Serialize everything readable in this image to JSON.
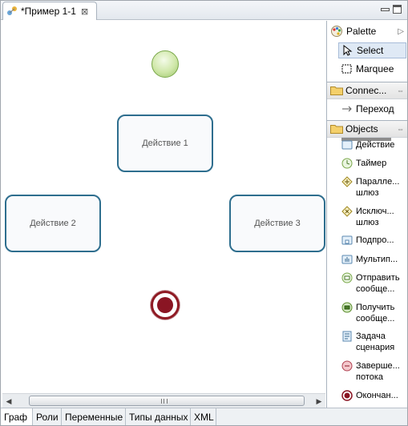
{
  "editor_tab": {
    "title": "*Пример 1-1",
    "close": "⊠"
  },
  "canvas": {
    "nodes": [
      "Действие 1",
      "Действие 2",
      "Действие 3"
    ]
  },
  "bottom_tabs": [
    "Граф",
    "Роли",
    "Переменные",
    "Типы данных",
    "XML"
  ],
  "palette": {
    "header": "Palette",
    "tools": [
      "Select",
      "Marquee"
    ],
    "connections_header": "Connec...",
    "connections": [
      "Переход"
    ],
    "objects_header": "Objects",
    "objects": [
      [
        "Действие"
      ],
      [
        "Таймер"
      ],
      [
        "Паралле...",
        "шлюз"
      ],
      [
        "Исключ...",
        "шлюз"
      ],
      [
        "Подпро..."
      ],
      [
        "Мультип..."
      ],
      [
        "Отправить",
        "сообще..."
      ],
      [
        "Получить",
        "сообще..."
      ],
      [
        "Задача",
        "сценария"
      ],
      [
        "Заверше...",
        "потока"
      ],
      [
        "Окончан..."
      ]
    ]
  },
  "colors": {
    "node_border": "#2e6e8e",
    "start_event": "#9cc56a",
    "end_event": "#8a1523"
  }
}
